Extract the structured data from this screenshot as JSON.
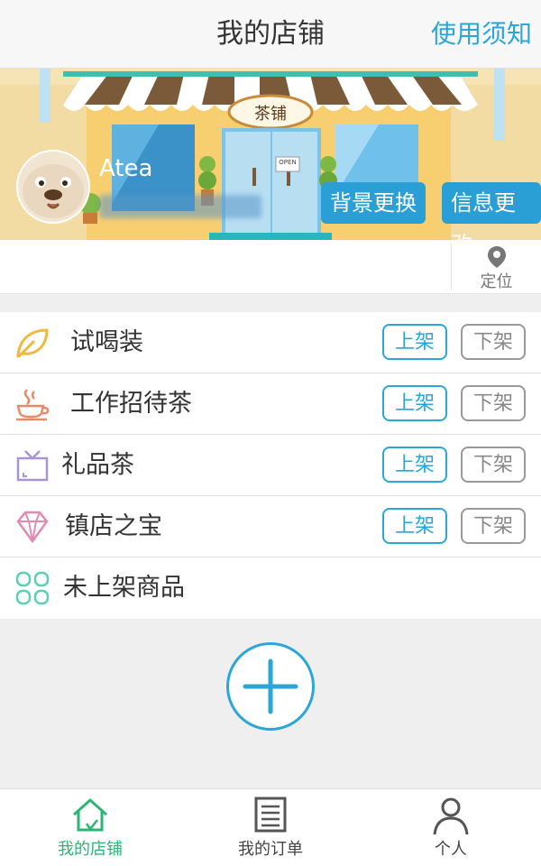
{
  "header": {
    "title": "我的店铺",
    "notice_label": "使用须知"
  },
  "banner": {
    "shop_sign": "茶铺",
    "door_sign": "OPEN",
    "shop_name": "Atea",
    "change_background_label": "背景更换",
    "change_info_label": "信息更改"
  },
  "location": {
    "label": "定位"
  },
  "categories": [
    {
      "label": "试喝装",
      "icon": "leaf-icon",
      "list_label": "上架",
      "unlist_label": "下架"
    },
    {
      "label": "工作招待茶",
      "icon": "teacup-icon",
      "list_label": "上架",
      "unlist_label": "下架"
    },
    {
      "label": "礼品茶",
      "icon": "gift-box-icon",
      "list_label": "上架",
      "unlist_label": "下架"
    },
    {
      "label": "镇店之宝",
      "icon": "diamond-icon",
      "list_label": "上架",
      "unlist_label": "下架"
    },
    {
      "label": "未上架商品",
      "icon": "grid-icon"
    }
  ],
  "tabbar": {
    "tabs": [
      {
        "label": "我的店铺",
        "icon": "home-icon",
        "active": true
      },
      {
        "label": "我的订单",
        "icon": "document-icon",
        "active": false
      },
      {
        "label": "个人",
        "icon": "user-icon",
        "active": false
      }
    ]
  },
  "colors": {
    "accent": "#2aa6d8",
    "active_tab": "#2ab673",
    "banner_button": "#2a9fd6"
  }
}
